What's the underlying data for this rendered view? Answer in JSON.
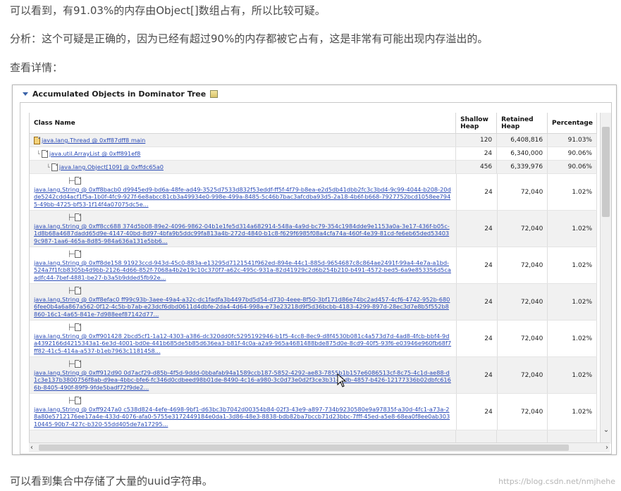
{
  "article": {
    "para1": "可以看到，有91.03%的内存由Object[]数组占有，所以比较可疑。",
    "para2": "分析：这个可疑是正确的，因为已经有超过90%的内存都被它占有，这是非常有可能出现内存溢出的。",
    "para3": "查看详情：",
    "para4": "可以看到集合中存储了大量的uuid字符串。"
  },
  "panel": {
    "title": "Accumulated Objects in Dominator Tree",
    "columns": {
      "class_name": "Class Name",
      "shallow": "Shallow\nHeap",
      "retained": "Retained\nHeap",
      "percentage": "Percentage"
    },
    "rows": [
      {
        "name": "java.lang.Thread @ 0xff87dff8 main",
        "shallow": "120",
        "retained": "6,408,816",
        "pct": "91.03%"
      },
      {
        "name": "java.util.ArrayList @ 0xff891ef8",
        "shallow": "24",
        "retained": "6,340,000",
        "pct": "90.06%"
      },
      {
        "name": "java.lang.Object[109] @ 0xffdc65a0",
        "shallow": "456",
        "retained": "6,339,976",
        "pct": "90.06%"
      }
    ],
    "string_rows": [
      {
        "name": "java.lang.String @ 0xff8bacb0 d9945ed9-bd6a-48fe-ad49-3525d7533d832f53eddf-ff5f-4f79-b8ea-e2d5db41dbb2fc3c3bd4-9c99-4044-b208-20dde5242cdd4acf1f5a-1b0f-4fc9-927f-6e8abcc81cb3a49934e0-998e-499a-8485-5c46b7bac3afcdba93d5-2a18-4b6f-b668-7927752bcd1058ee7945-49bb-4725-bf53-1f14f4a07075dc5e...",
        "shallow": "24",
        "retained": "72,040",
        "pct": "1.02%"
      },
      {
        "name": "java.lang.String @ 0xff8cc688 374d5b08-89e2-4096-9862-04b1e1fe5d314a682914-548a-4a9d-bc79-354c1984dde9e1153a0a-3e17-436f-b05c-1d8b68a4687dadd65d9e-4147-40bd-8d97-4bfa9b5ddc99fa813a4b-272d-4840-b1c8-f629f6985f08a4cfa74a-460f-4e39-81cd-fe6eb65ded534039c987-1aa6-465a-8d85-984a636a131e5bb6...",
        "shallow": "24",
        "retained": "72,040",
        "pct": "1.02%"
      },
      {
        "name": "java.lang.String @ 0xff8de158 91923ccd-943d-45c0-883a-e13295d7121541f962ed-894e-44c1-885d-9654687c8c864ae2491f-99a4-4e7a-a1bd-524a7f1fcb8305b4d9bb-2126-4d66-852f-7068a4b2e19c10c370f7-a62c-495c-931a-82d41929c2d6b254b210-b491-4572-bed5-6a9e853356d5caadfc44-7bef-4881-be27-b3a5b9dded5fb92e...",
        "shallow": "24",
        "retained": "72,040",
        "pct": "1.02%"
      },
      {
        "name": "java.lang.String @ 0xff8efac0 ff99c93b-3aee-49a4-a32c-dc1fadfa3b4497bd5d54-d730-4eee-8f50-3bf171d86e74bc2ad457-4cf6-4742-952b-6806fee0b4a6a867a562-0f12-4c5b-b7ab-e23dcf6dbd0611d4dbfe-2da4-4d64-998a-e73e23218d9f5d36bcbb-4183-4299-897d-28ec3d7e8b5f552b8860-16c1-4a65-841e-7d988eef87142d77...",
        "shallow": "24",
        "retained": "72,040",
        "pct": "1.02%"
      },
      {
        "name": "java.lang.String @ 0xff901428 2bcd5cf1-1a12-4303-a386-dc320dd0fc5295192946-b1f5-4cc8-8ec9-d8f4530b081c4a573d7d-4ad8-4fcb-bbf4-9da4392166d4215343a1-6e3d-4001-bd0e-441b685de5b85d636ea3-b81f-4c0a-a2a9-965a4681488bde875d0e-8cd9-40f5-93f6-e03946e960fb68f7ff82-41c5-414a-a537-b1eb7963c1181458...",
        "shallow": "24",
        "retained": "72,040",
        "pct": "1.02%"
      },
      {
        "name": "java.lang.String @ 0xff912d90 0d7acf29-d85b-4f5d-9ddd-0bbafab94a1589ccb187-5852-4292-ae83-7855b1b157e6086513cf-8c75-4c1d-ae88-d1c3e137b3800756f8ab-d9ea-4bbc-bfe6-fc346d0cdbeed98b01de-8490-4c16-a980-3c0d73e0d2f3ce3b31-f5db-4857-b426-12177336b02dbfc6166b-8405-490f-89f9-9fde5badf72f9de2...",
        "shallow": "24",
        "retained": "72,040",
        "pct": "1.02%"
      },
      {
        "name": "java.lang.String @ 0xff9247a0 c538d824-4efe-4698-9bf1-d63bc3b7042d00354b84-02f3-43e9-a897-734b9230580e9a97835f-a30d-4fc1-a73a-28a80e5712176ee17a4e-433d-4076-afa0-5755e3172449184e0da1-3d86-48e3-8838-bdb82ba7bccb71d23bbc-7fff-45ed-a5e8-68ea0f8ee0ab30310445-90b7-427c-b320-55dd405de7a17295...",
        "shallow": "24",
        "retained": "72,040",
        "pct": "1.02%"
      }
    ]
  },
  "watermark": "https://blog.csdn.net/nmjhehe"
}
